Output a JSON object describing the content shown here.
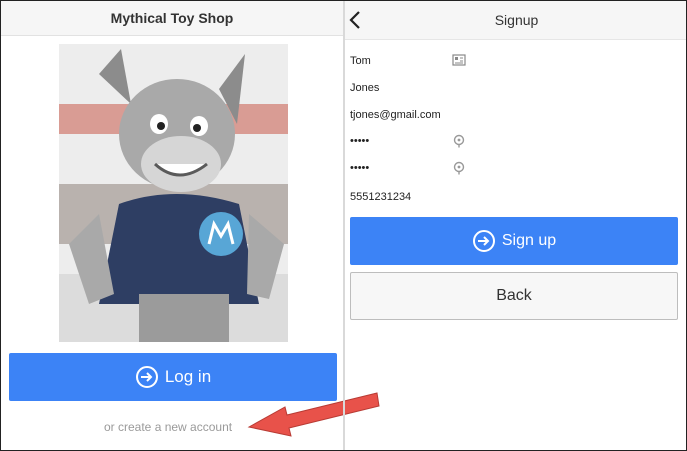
{
  "login_screen": {
    "title": "Mythical Toy Shop",
    "login_label": "Log in",
    "create_account_link": "or create a new account"
  },
  "signup_screen": {
    "title": "Signup",
    "first_name": "Tom",
    "last_name": "Jones",
    "email": "tjones@gmail.com",
    "password": "•••••",
    "confirm_password": "•••••",
    "phone": "5551231234",
    "signup_label": "Sign up",
    "back_label": "Back"
  },
  "colors": {
    "primary": "#3c83f6",
    "annotation_arrow": "#e8524a"
  },
  "icons": [
    "chevron-left-icon",
    "contact-card-icon",
    "key-icon",
    "login-arrow-icon"
  ]
}
